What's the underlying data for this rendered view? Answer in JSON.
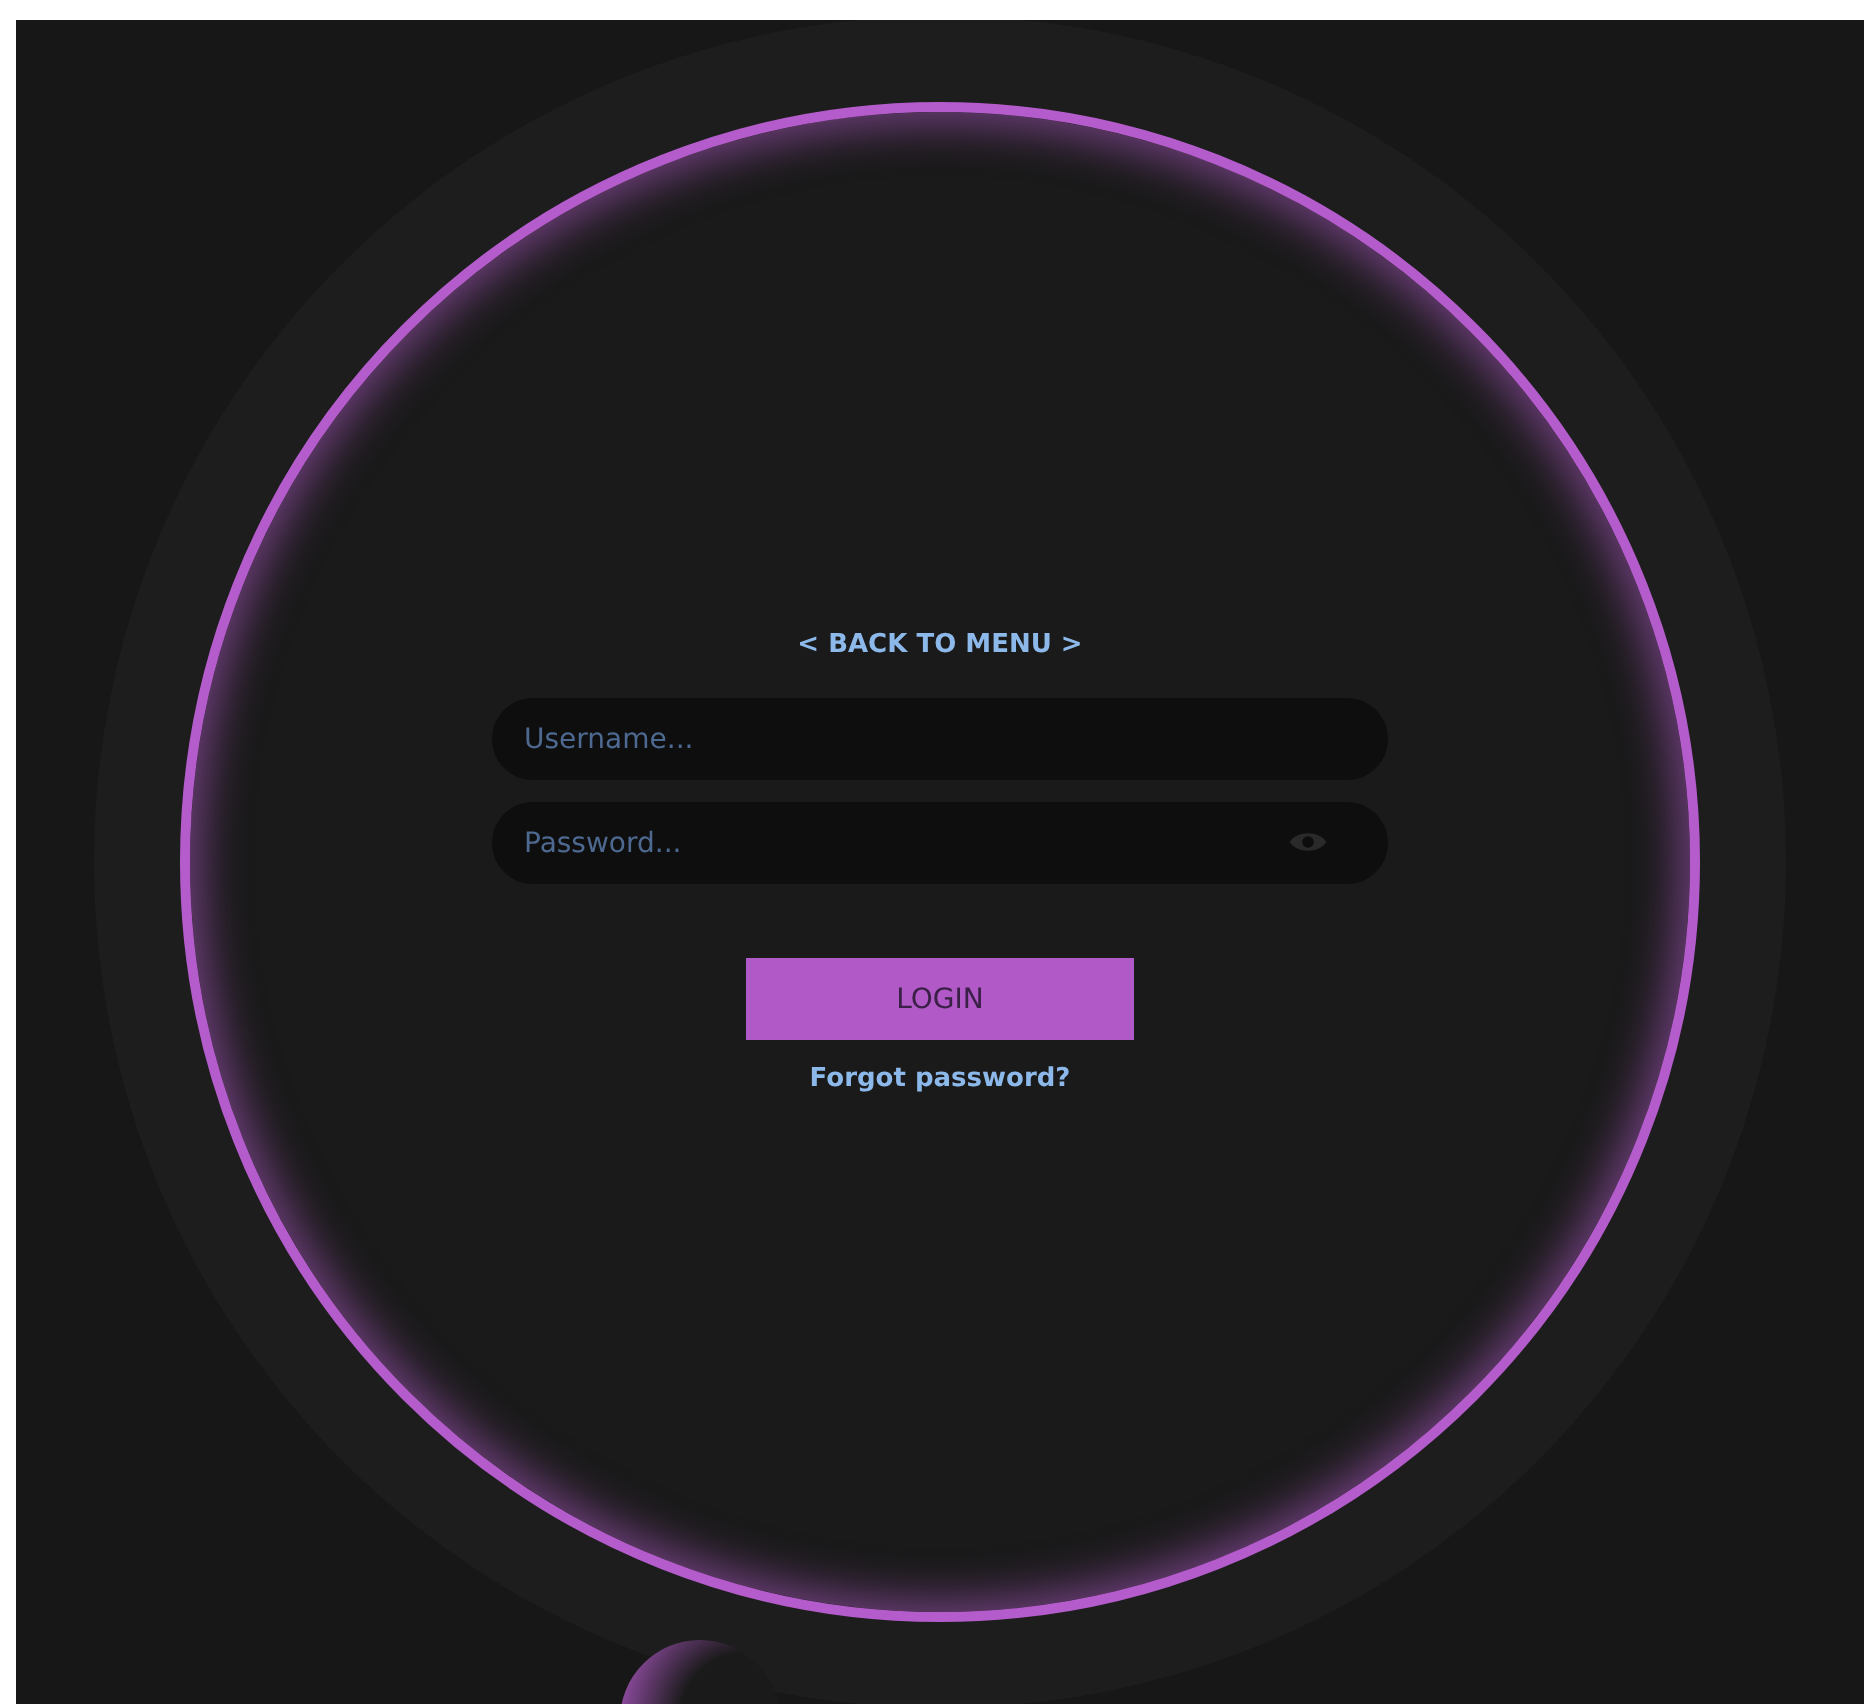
{
  "back_link": "< BACK TO MENU >",
  "fields": [
    {
      "kind": "text",
      "placeholder": "Username..."
    },
    {
      "kind": "password",
      "placeholder": "Password..."
    }
  ],
  "login_button": "LOGIN",
  "forgot_link": "Forgot password?"
}
